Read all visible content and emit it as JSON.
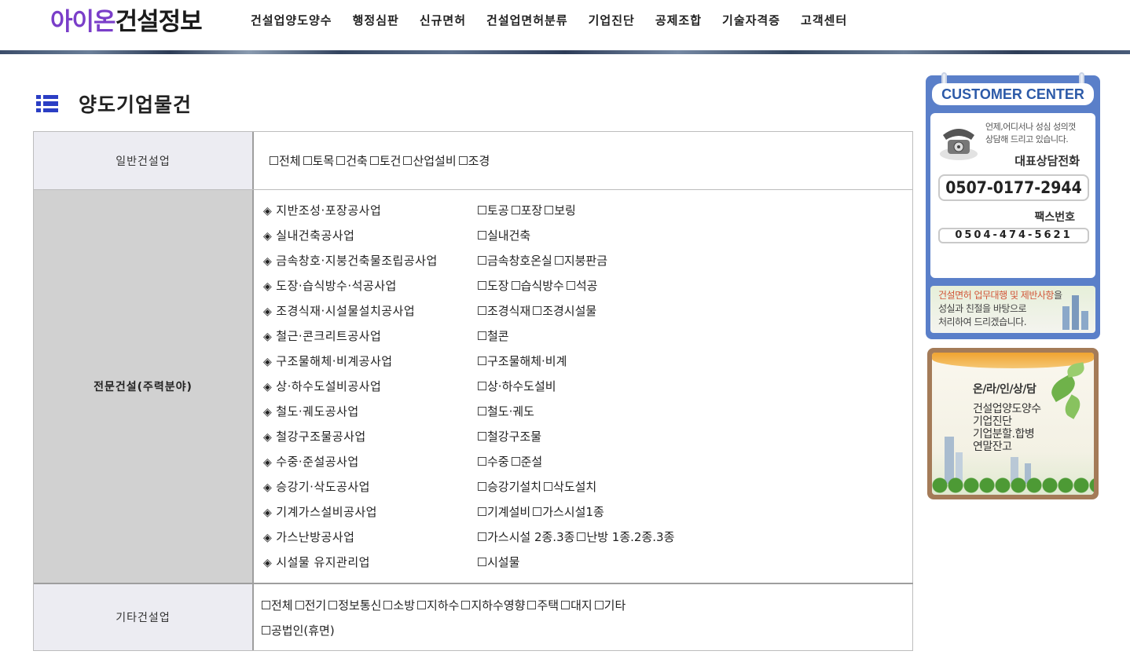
{
  "header": {
    "logo_part1": "아이온",
    "logo_part2": "건설정보",
    "nav": [
      "건설업양도양수",
      "행정심판",
      "신규면허",
      "건설업면허분류",
      "기업진단",
      "공제조합",
      "기술자격증",
      "고객센터"
    ]
  },
  "page": {
    "title": "양도기업물건"
  },
  "general": {
    "label": "일반건설업",
    "options": [
      "전체",
      "토목",
      "건축",
      "토건",
      "산업설비",
      "조경"
    ]
  },
  "special": {
    "label": "전문건설(주력분야)",
    "marker": "◈",
    "items": [
      {
        "name": "지반조성·포장공사업",
        "options": [
          "토공",
          "포장",
          "보링"
        ]
      },
      {
        "name": "실내건축공사업",
        "options": [
          "실내건축"
        ]
      },
      {
        "name": "금속창호·지붕건축물조립공사업",
        "options": [
          "금속창호온실",
          "지붕판금"
        ]
      },
      {
        "name": "도장·습식방수·석공사업",
        "options": [
          "도장",
          "습식방수",
          "석공"
        ]
      },
      {
        "name": "조경식재·시설물설치공사업",
        "options": [
          "조경식재",
          "조경시설물"
        ]
      },
      {
        "name": "철근·콘크리트공사업",
        "options": [
          "철콘"
        ]
      },
      {
        "name": "구조물해체·비계공사업",
        "options": [
          "구조물해체·비계"
        ]
      },
      {
        "name": "상·하수도설비공사업",
        "options": [
          "상·하수도설비"
        ]
      },
      {
        "name": "철도·궤도공사업",
        "options": [
          "철도·궤도"
        ]
      },
      {
        "name": "철강구조물공사업",
        "options": [
          "철강구조물"
        ]
      },
      {
        "name": "수중·준설공사업",
        "options": [
          "수중",
          "준설"
        ]
      },
      {
        "name": "승강기·삭도공사업",
        "options": [
          "승강기설치",
          "삭도설치"
        ]
      },
      {
        "name": "기계가스설비공사업",
        "options": [
          "기계설비",
          "가스시설1종"
        ]
      },
      {
        "name": "가스난방공사업",
        "options": [
          "가스시설 2종.3종",
          "난방 1종.2종.3종"
        ]
      },
      {
        "name": "시설물 유지관리업",
        "options": [
          "시설물"
        ]
      }
    ]
  },
  "other": {
    "label": "기타건설업",
    "options": [
      "전체",
      "전기",
      "정보통신",
      "소방",
      "지하수",
      "지하수영향",
      "주택",
      "대지",
      "기타",
      "공법인(휴면)"
    ]
  },
  "sidebar": {
    "customer_center": {
      "title": "CUSTOMER CENTER",
      "message_line1": "언제,어디서나 성심 성의껏",
      "message_line2": "상담해 드리고 있습니다.",
      "rep_label": "대표상담전화",
      "phone": "0507-0177-2944",
      "fax_label": "팩스번호",
      "fax": "0504-474-5621",
      "bottom_highlight": "건설면허 업무대행 및 제반사항",
      "bottom_line1_rest": "을",
      "bottom_line2": "성실과 친절을 바탕으로",
      "bottom_line3": "처리하여 드리겠습니다."
    },
    "online": {
      "title": "온/라/인/상/담",
      "lines": [
        "건설업양도양수",
        "기업진단",
        "기업분할.합병",
        "연말잔고"
      ]
    }
  },
  "colors": {
    "logo_accent": "#7a3ec9",
    "title_icon": "#2b3ec4",
    "cc_blue": "#5a7fc9",
    "online_frame": "#a47b58"
  }
}
